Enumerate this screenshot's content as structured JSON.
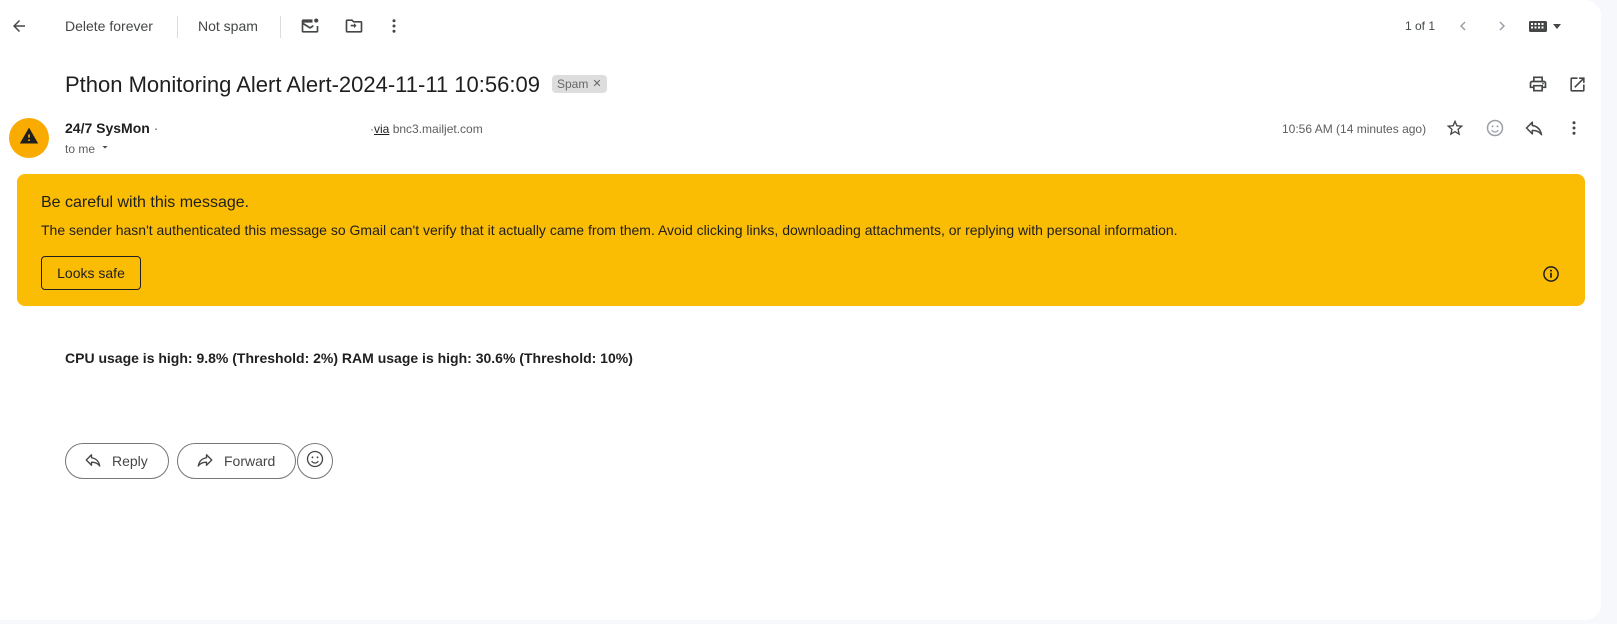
{
  "toolbar": {
    "delete_forever": "Delete forever",
    "not_spam": "Not spam",
    "pager": "1 of 1"
  },
  "message": {
    "subject": "Pthon Monitoring Alert Alert-2024-11-11 10:56:09",
    "label_chip": "Spam",
    "sender_name": "24/7 SysMon",
    "via_label": "via",
    "via_domain": "bnc3.mailjet.com",
    "recipient": "to me",
    "time": "10:56 AM (14 minutes ago)",
    "body": "CPU usage is high: 9.8% (Threshold: 2%) RAM usage is high: 30.6% (Threshold: 10%)"
  },
  "warning": {
    "title": "Be careful with this message.",
    "text": "The sender hasn't authenticated this message so Gmail can't verify that it actually came from them. Avoid clicking links, downloading attachments, or replying with personal information.",
    "button": "Looks safe"
  },
  "actions": {
    "reply": "Reply",
    "forward": "Forward"
  },
  "colors": {
    "warning_bg": "#fbbc04",
    "avatar_bg": "#f9ab00",
    "page_bg": "#f6f8fc"
  },
  "icons": [
    "back-arrow-icon",
    "mark-unread-icon",
    "move-to-icon",
    "more-vert-icon",
    "chevron-left-icon",
    "chevron-right-icon",
    "keyboard-icon",
    "print-icon",
    "open-new-window-icon",
    "warning-icon",
    "star-icon",
    "emoji-icon",
    "reply-icon",
    "info-icon",
    "forward-icon"
  ]
}
